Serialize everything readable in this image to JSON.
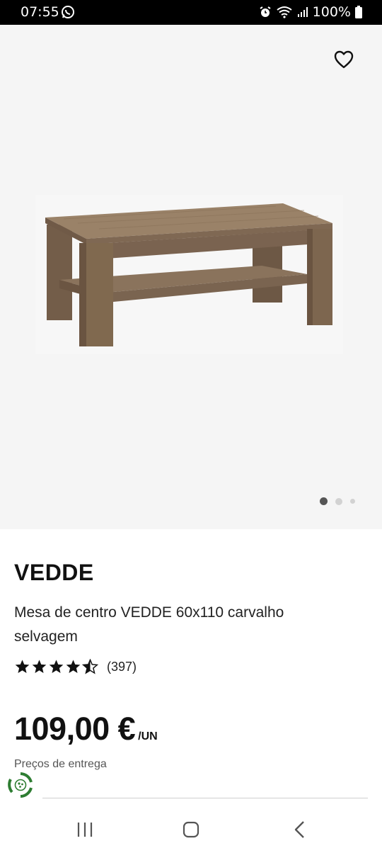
{
  "status_bar": {
    "time": "07:55",
    "battery": "100%"
  },
  "gallery": {
    "image_count": 3,
    "active_index": 0
  },
  "product": {
    "brand": "VEDDE",
    "description": "Mesa de centro VEDDE 60x110 carvalho selvagem",
    "rating": 4.5,
    "review_count": "(397)",
    "price": "109,00 €",
    "price_unit": "/UN",
    "delivery_label": "Preços de entrega"
  },
  "colors": {
    "gallery_bg": "#f5f5f5",
    "text": "#111111",
    "eco_green": "#2e7d32",
    "wood": "#7b6550"
  },
  "icons": {
    "favorite": "heart-outline-icon",
    "eco": "eco-recycle-icon",
    "nav_recents": "recent-apps-icon",
    "nav_home": "home-icon",
    "nav_back": "back-icon"
  }
}
